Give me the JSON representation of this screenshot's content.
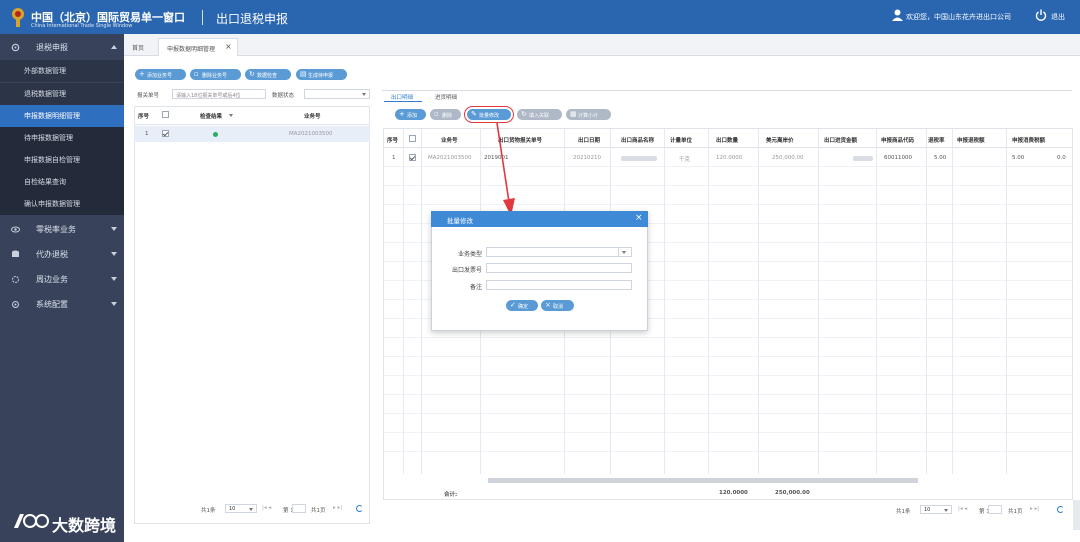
{
  "header": {
    "brand_cn": "中国（北京）国际贸易单一窗口",
    "brand_en": "China International Trade Single Window",
    "system_title": "出口退税申报",
    "welcome": "欢迎您，中国山东花卉进出口公司",
    "logout": "退出"
  },
  "sidebar": {
    "items": [
      {
        "label": "退税申报"
      },
      {
        "label": "零税率业务"
      },
      {
        "label": "代办退税"
      },
      {
        "label": "周边业务"
      },
      {
        "label": "系统配置"
      }
    ],
    "subs": [
      {
        "label": "外部数据管理"
      },
      {
        "label": "退税数据管理"
      }
    ],
    "leaves": [
      {
        "label": "申报数据明细管理"
      },
      {
        "label": "待申报数据管理"
      },
      {
        "label": "申报数据自检管理"
      },
      {
        "label": "自检结果查询"
      },
      {
        "label": "确认申报数据管理"
      }
    ]
  },
  "watermark": {
    "text": "大数跨境"
  },
  "tabs": {
    "home": "首页",
    "active": "申报数据明细管理"
  },
  "left_panel": {
    "buttons": [
      "添加业务号",
      "删除业务号",
      "数据检查",
      "生成待申报"
    ],
    "filter_label1": "报关单号",
    "filter_placeholder1": "请输入18位报关单号或后4位",
    "filter_label2": "数据状态",
    "columns": {
      "seq": "序号",
      "check": "检查结果",
      "biz": "业务号"
    },
    "rows": [
      {
        "seq": "1",
        "biz": "MA2021003500"
      }
    ],
    "pager": {
      "total": "共1条",
      "size": "10",
      "page": "第 1",
      "pages": "共1页"
    }
  },
  "right_panel": {
    "tabs": [
      "出口明细",
      "进货明细"
    ],
    "buttons": [
      "添加",
      "删除",
      "批量修改",
      "填入关联",
      "计算小计"
    ],
    "columns": [
      "序号",
      "业务号",
      "出口货物报关单号",
      "出口日期",
      "出口商品名称",
      "计量单位",
      "出口数量",
      "美元离岸价",
      "出口进货金额",
      "申报商品代码",
      "退税率",
      "申报退税额",
      "申报消费税额"
    ],
    "row": {
      "seq": "1",
      "biz": "MA2021003500",
      "decl": "2019001",
      "date": "20210210",
      "product": "",
      "unit": "千克",
      "qty": "120.0000",
      "usd": "250,000.00",
      "purchase": "",
      "code": "60011000",
      "rate": "5.00",
      "refund": "5.00",
      "consume": "0.0"
    },
    "total_label": "合计:",
    "total_qty": "120.0000",
    "total_usd": "250,000.00",
    "pager": {
      "total": "共1条",
      "size": "10",
      "page": "第 1",
      "pages": "共1页"
    }
  },
  "dialog": {
    "title": "批量修改",
    "field1": "业务类型",
    "field2": "出口发票号",
    "field3": "备注",
    "ok": "确定",
    "cancel": "取消"
  },
  "colors": {
    "header": "#2a66b0",
    "sidebar": "#38425a",
    "active": "#2f6fc0",
    "button": "#5b9bd5",
    "highlight": "#e0393e"
  }
}
